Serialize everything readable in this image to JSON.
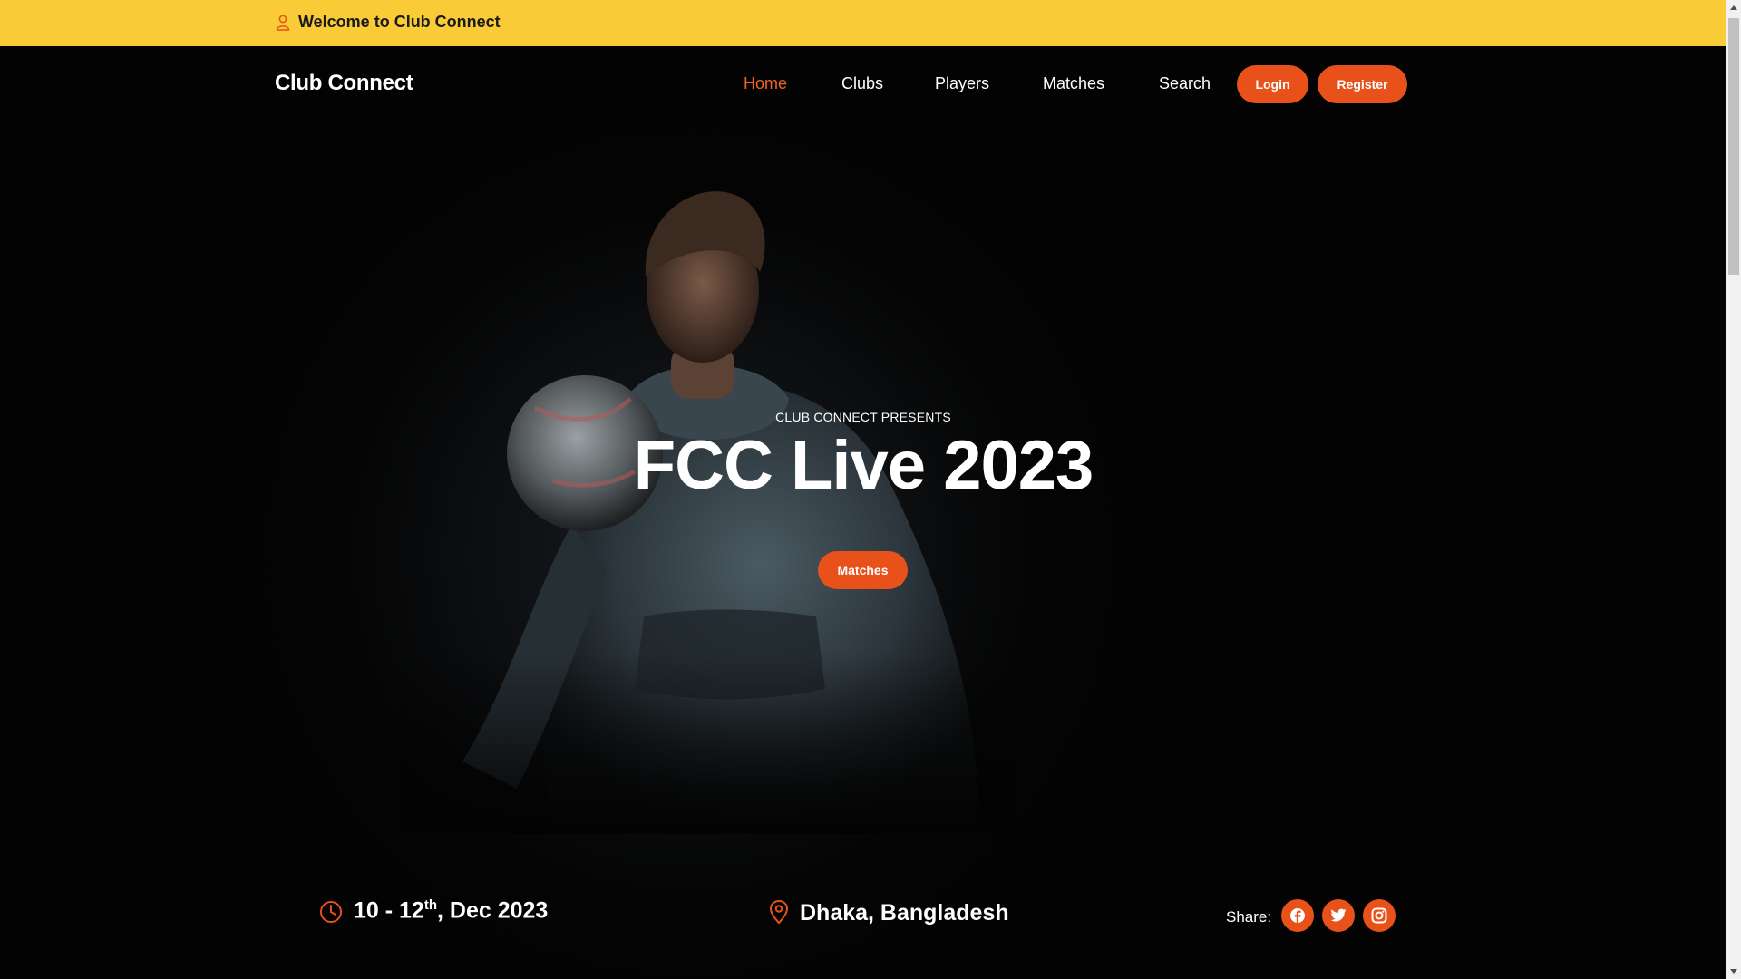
{
  "topbar": {
    "welcome_text": "Welcome to Club Connect"
  },
  "navbar": {
    "brand": "Club Connect",
    "links": [
      {
        "label": "Home",
        "active": true
      },
      {
        "label": "Clubs",
        "active": false
      },
      {
        "label": "Players",
        "active": false
      },
      {
        "label": "Matches",
        "active": false
      },
      {
        "label": "Search",
        "active": false
      }
    ],
    "login_label": "Login",
    "register_label": "Register"
  },
  "hero": {
    "presents": "CLUB CONNECT PRESENTS",
    "title": "FCC Live 2023",
    "button_label": "Matches"
  },
  "info": {
    "date_prefix": "10 - 12",
    "date_sup": "th",
    "date_suffix": ", Dec 2023",
    "location": "Dhaka, Bangladesh",
    "share_label": "Share:",
    "social_icons": [
      "facebook-icon",
      "twitter-icon",
      "instagram-icon"
    ]
  },
  "colors": {
    "topbar": "#f9cb37",
    "accent": "#e8511a",
    "active_link": "#f26522",
    "background": "#030303"
  }
}
